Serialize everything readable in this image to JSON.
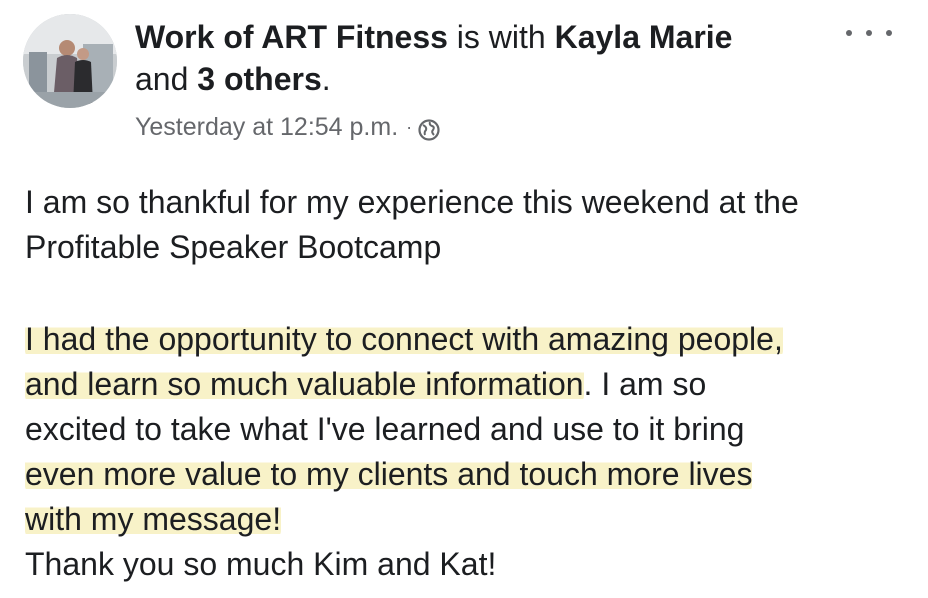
{
  "post": {
    "author": "Work of ART Fitness",
    "with_text": " is with ",
    "tagged": "Kayla Marie",
    "and_text": "and ",
    "others": "3 others",
    "period": ".",
    "timestamp": "Yesterday at 12:54 p.m.",
    "separator": "·",
    "privacy_icon": "globe-icon",
    "menu_icon": "more-options-icon",
    "body": {
      "p1": "I am so thankful for my experience this weekend at the",
      "p1b": "Profitable Speaker Bootcamp",
      "p2_l1": "I had the opportunity to connect with amazing people,",
      "p2_l2_hl": "and learn so much valuable information",
      "p2_l2_rest": ". I am so",
      "p2_l3": "excited to take what I've learned and use to it bring",
      "p2_l4": "even more value to my clients and touch more lives",
      "p2_l5": "with my message!",
      "p3": "Thank you so much Kim and Kat!"
    }
  },
  "colors": {
    "text": "#1c1e21",
    "meta": "#65676b",
    "highlight": "#f8f2c8"
  }
}
